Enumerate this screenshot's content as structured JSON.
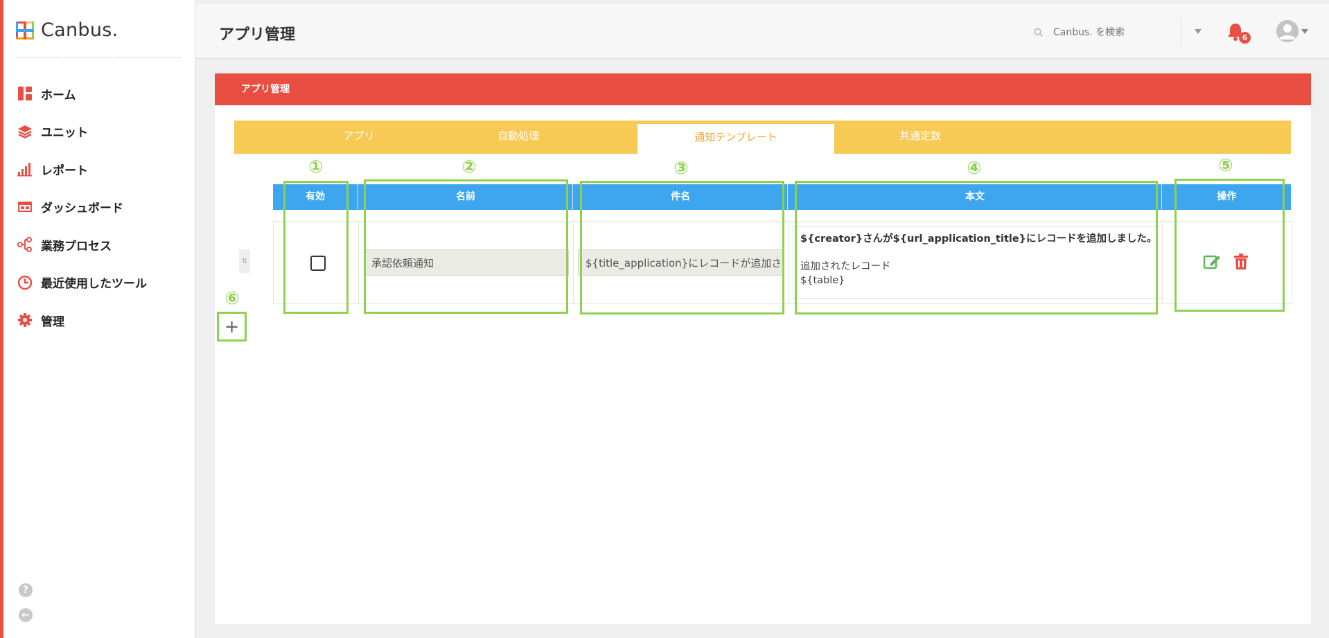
{
  "app": {
    "logo_text": "Canbus."
  },
  "sidebar": {
    "items": [
      {
        "label": "ホーム",
        "icon": "dashboard-grid-icon"
      },
      {
        "label": "ユニット",
        "icon": "layers-icon"
      },
      {
        "label": "レポート",
        "icon": "bar-chart-icon"
      },
      {
        "label": "ダッシュボード",
        "icon": "monitor-icon"
      },
      {
        "label": "業務プロセス",
        "icon": "process-flow-icon"
      },
      {
        "label": "最近使用したツール",
        "icon": "clock-icon"
      },
      {
        "label": "管理",
        "icon": "gear-icon"
      }
    ],
    "bottom": {
      "help_icon": "question-icon",
      "collapse_icon": "arrow-left-icon"
    }
  },
  "header": {
    "title": "アプリ管理",
    "search_placeholder": "Canbus. を検索",
    "notification_count": "6"
  },
  "panel": {
    "title": "アプリ管理",
    "tabs": [
      {
        "label": "アプリ",
        "active": false
      },
      {
        "label": "自動処理",
        "active": false
      },
      {
        "label": "通知テンプレート",
        "active": true
      },
      {
        "label": "共通定数",
        "active": false
      }
    ],
    "table": {
      "columns": [
        "有効",
        "名前",
        "件名",
        "本文",
        "操作"
      ],
      "rows": [
        {
          "enabled": false,
          "name": "承認依頼通知",
          "subject": "${title_application}にレコードが追加さ",
          "body_line1": "${creator}さんが${url_application_title}にレコードを追加しました。",
          "body_line2": "追加されたレコード",
          "body_line3": "${table}"
        }
      ]
    },
    "annotations": [
      "①",
      "②",
      "③",
      "④",
      "⑤",
      "⑥"
    ],
    "add_button_label": "+"
  },
  "colors": {
    "accent_red": "#e94e43",
    "tab_yellow": "#f7c955",
    "header_blue": "#3da6ef",
    "annotation_green": "#8fd14f",
    "edit_green": "#5cb85c",
    "delete_red": "#e94e43"
  }
}
